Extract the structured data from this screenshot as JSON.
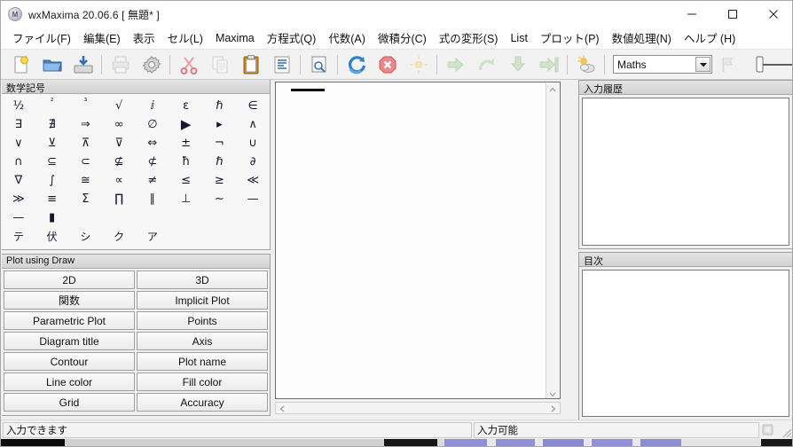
{
  "window": {
    "app_icon": "maxima-logo-icon",
    "title": "wxMaxima 20.06.6 [ 無題* ]",
    "minimize_label": "—",
    "maximize_label": "□",
    "close_label": "✕"
  },
  "menu": {
    "items": [
      {
        "label": "ファイル(F)",
        "name": "menu-file"
      },
      {
        "label": "編集(E)",
        "name": "menu-edit"
      },
      {
        "label": "表示",
        "name": "menu-view"
      },
      {
        "label": "セル(L)",
        "name": "menu-cell"
      },
      {
        "label": "Maxima",
        "name": "menu-maxima"
      },
      {
        "label": "方程式(Q)",
        "name": "menu-equations"
      },
      {
        "label": "代数(A)",
        "name": "menu-algebra"
      },
      {
        "label": "微積分(C)",
        "name": "menu-calculus"
      },
      {
        "label": "式の変形(S)",
        "name": "menu-simplify"
      },
      {
        "label": "List",
        "name": "menu-list"
      },
      {
        "label": "プロット(P)",
        "name": "menu-plot"
      },
      {
        "label": "数値処理(N)",
        "name": "menu-numeric"
      },
      {
        "label": "ヘルプ (H)",
        "name": "menu-help"
      }
    ]
  },
  "toolbar": {
    "buttons": [
      {
        "icon": "new-document-icon",
        "enabled": true
      },
      {
        "icon": "open-folder-icon",
        "enabled": true
      },
      {
        "icon": "save-icon",
        "enabled": true
      },
      {
        "sep": true
      },
      {
        "icon": "print-icon",
        "enabled": false
      },
      {
        "icon": "preferences-gear-icon",
        "enabled": true
      },
      {
        "sep": true
      },
      {
        "icon": "cut-scissors-icon",
        "enabled": true
      },
      {
        "icon": "copy-icon",
        "enabled": false
      },
      {
        "icon": "paste-clipboard-icon",
        "enabled": true
      },
      {
        "icon": "select-all-icon",
        "enabled": true
      },
      {
        "sep": true
      },
      {
        "icon": "find-replace-icon",
        "enabled": true
      },
      {
        "sep": true
      },
      {
        "icon": "restart-maxima-icon",
        "enabled": true
      },
      {
        "icon": "interrupt-stop-icon",
        "enabled": true
      },
      {
        "icon": "evaluate-sun-icon",
        "enabled": false
      },
      {
        "sep": true
      },
      {
        "icon": "evaluate-cell-arrow-icon",
        "enabled": false
      },
      {
        "icon": "evaluate-rest-icon",
        "enabled": false
      },
      {
        "icon": "evaluate-all-down-icon",
        "enabled": false
      },
      {
        "icon": "evaluate-to-point-icon",
        "enabled": false
      },
      {
        "sep": true
      },
      {
        "icon": "animation-suncloud-icon",
        "enabled": true
      },
      {
        "sep": true
      }
    ],
    "style_combo": {
      "value": "Maths",
      "name": "text-style-combo"
    },
    "flag_button": {
      "icon": "flag-icon",
      "enabled": false
    },
    "zoom_slider": {
      "name": "font-size-slider",
      "value": 0
    }
  },
  "symbols_panel": {
    "title": "数学記号",
    "symbols": [
      {
        "g": "½",
        "cls": ""
      },
      {
        "g": "²",
        "cls": "sup"
      },
      {
        "g": "³",
        "cls": "sup"
      },
      {
        "g": "√",
        "cls": ""
      },
      {
        "g": "ⅈ",
        "cls": ""
      },
      {
        "g": "ε",
        "cls": ""
      },
      {
        "g": "ℏ",
        "cls": ""
      },
      {
        "g": "∈",
        "cls": ""
      },
      {
        "g": "∃",
        "cls": ""
      },
      {
        "g": "∄",
        "cls": ""
      },
      {
        "g": "⇒",
        "cls": ""
      },
      {
        "g": "∞",
        "cls": ""
      },
      {
        "g": "∅",
        "cls": ""
      },
      {
        "g": "▶",
        "cls": "big"
      },
      {
        "g": "▸",
        "cls": ""
      },
      {
        "g": "∧",
        "cls": ""
      },
      {
        "g": "∨",
        "cls": ""
      },
      {
        "g": "⊻",
        "cls": ""
      },
      {
        "g": "⊼",
        "cls": ""
      },
      {
        "g": "⊽",
        "cls": ""
      },
      {
        "g": "⇔",
        "cls": ""
      },
      {
        "g": "±",
        "cls": ""
      },
      {
        "g": "¬",
        "cls": ""
      },
      {
        "g": "∪",
        "cls": ""
      },
      {
        "g": "∩",
        "cls": ""
      },
      {
        "g": "⊆",
        "cls": ""
      },
      {
        "g": "⊂",
        "cls": ""
      },
      {
        "g": "⊈",
        "cls": ""
      },
      {
        "g": "⊄",
        "cls": ""
      },
      {
        "g": "ħ",
        "cls": ""
      },
      {
        "g": "ℏ",
        "cls": ""
      },
      {
        "g": "∂",
        "cls": ""
      },
      {
        "g": "∇",
        "cls": ""
      },
      {
        "g": "∫",
        "cls": ""
      },
      {
        "g": "≅",
        "cls": ""
      },
      {
        "g": "∝",
        "cls": ""
      },
      {
        "g": "≠",
        "cls": ""
      },
      {
        "g": "≤",
        "cls": ""
      },
      {
        "g": "≥",
        "cls": ""
      },
      {
        "g": "≪",
        "cls": ""
      },
      {
        "g": "≫",
        "cls": ""
      },
      {
        "g": "≡",
        "cls": ""
      },
      {
        "g": "Σ",
        "cls": ""
      },
      {
        "g": "∏",
        "cls": ""
      },
      {
        "g": "∥",
        "cls": ""
      },
      {
        "g": "⊥",
        "cls": ""
      },
      {
        "g": "∼",
        "cls": ""
      },
      {
        "g": "—",
        "cls": ""
      },
      {
        "g": "—",
        "cls": ""
      },
      {
        "g": "▮",
        "cls": ""
      },
      {
        "g": "",
        "cls": ""
      },
      {
        "g": "",
        "cls": ""
      },
      {
        "g": "",
        "cls": ""
      },
      {
        "g": "",
        "cls": ""
      },
      {
        "g": "",
        "cls": ""
      },
      {
        "g": "",
        "cls": ""
      },
      {
        "g": "テ",
        "cls": "cjk"
      },
      {
        "g": "伏",
        "cls": "cjk"
      },
      {
        "g": "シ",
        "cls": "cjk"
      },
      {
        "g": "ク",
        "cls": "cjk"
      },
      {
        "g": "ア",
        "cls": "cjk"
      },
      {
        "g": "",
        "cls": ""
      },
      {
        "g": "",
        "cls": ""
      },
      {
        "g": "",
        "cls": ""
      }
    ]
  },
  "draw_panel": {
    "title": "Plot using Draw",
    "buttons": [
      {
        "label": "2D",
        "name": "draw-btn-2d"
      },
      {
        "label": "3D",
        "name": "draw-btn-3d"
      },
      {
        "label": "関数",
        "name": "draw-btn-function"
      },
      {
        "label": "Implicit Plot",
        "name": "draw-btn-implicit-plot"
      },
      {
        "label": "Parametric Plot",
        "name": "draw-btn-parametric-plot"
      },
      {
        "label": "Points",
        "name": "draw-btn-points"
      },
      {
        "label": "Diagram title",
        "name": "draw-btn-diagram-title"
      },
      {
        "label": "Axis",
        "name": "draw-btn-axis"
      },
      {
        "label": "Contour",
        "name": "draw-btn-contour"
      },
      {
        "label": "Plot name",
        "name": "draw-btn-plot-name"
      },
      {
        "label": "Line color",
        "name": "draw-btn-line-color"
      },
      {
        "label": "Fill color",
        "name": "draw-btn-fill-color"
      },
      {
        "label": "Grid",
        "name": "draw-btn-grid"
      },
      {
        "label": "Accuracy",
        "name": "draw-btn-accuracy"
      }
    ]
  },
  "worksheet": {
    "content": "",
    "cell_marker": true
  },
  "history_panel": {
    "title": "入力履歴",
    "content": ""
  },
  "toc_panel": {
    "title": "目次",
    "content": ""
  },
  "statusbar": {
    "left": "入力できます",
    "right": "入力可能"
  }
}
